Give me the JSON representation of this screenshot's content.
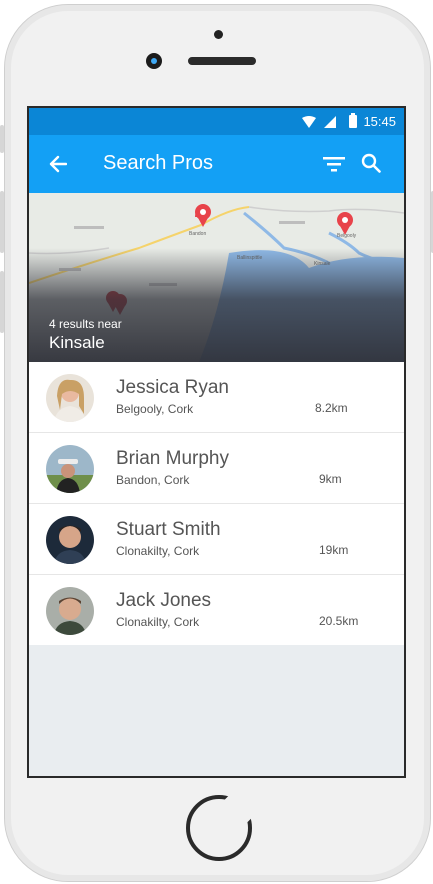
{
  "status_bar": {
    "time": "15:45"
  },
  "app_bar": {
    "title": "Search Pros"
  },
  "map": {
    "results_text": "4 results near",
    "location": "Kinsale",
    "labels": [
      "Bandon",
      "Ballinspittle",
      "Kinsale",
      "Belgooly"
    ]
  },
  "pros": [
    {
      "name": "Jessica Ryan",
      "location": "Belgooly, Cork",
      "distance": "8.2km"
    },
    {
      "name": "Brian Murphy",
      "location": "Bandon, Cork",
      "distance": "9km"
    },
    {
      "name": "Stuart Smith",
      "location": "Clonakilty, Cork",
      "distance": "19km"
    },
    {
      "name": "Jack Jones",
      "location": "Clonakilty, Cork",
      "distance": "20.5km"
    }
  ],
  "colors": {
    "app_bar": "#13a0f5",
    "status_bar": "#0b86d6",
    "pin": "#e8434a"
  }
}
